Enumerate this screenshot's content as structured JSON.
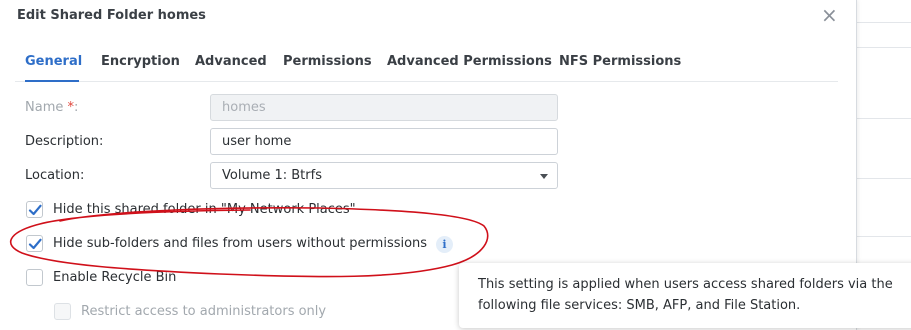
{
  "dialog": {
    "title": "Edit Shared Folder homes",
    "close_symbol": "×"
  },
  "tabs": [
    {
      "label": "General",
      "active": true
    },
    {
      "label": "Encryption",
      "active": false
    },
    {
      "label": "Advanced",
      "active": false
    },
    {
      "label": "Permissions",
      "active": false
    },
    {
      "label": "Advanced Permissions",
      "active": false
    },
    {
      "label": "NFS Permissions",
      "active": false
    }
  ],
  "form": {
    "name_label": "Name",
    "required_mark": "*",
    "name_colon": ":",
    "name_value": "homes",
    "description_label": "Description:",
    "description_value": "user home",
    "location_label": "Location:",
    "location_value": "Volume 1:  Btrfs"
  },
  "options": {
    "hide_folder": {
      "label": "Hide this shared folder in \"My Network Places\"",
      "checked": true
    },
    "hide_subfolders": {
      "label": "Hide sub-folders and files from users without permissions",
      "checked": true
    },
    "recycle_bin": {
      "label": "Enable Recycle Bin",
      "checked": false
    },
    "restrict_admins": {
      "label": "Restrict access to administrators only",
      "checked": false,
      "disabled": true
    }
  },
  "info_icon": "i",
  "tooltip": {
    "line1": "This setting is applied when users access shared folders via the",
    "line2": "following file services: SMB, AFP, and File Station."
  },
  "colors": {
    "accent": "#2e6ec8",
    "required": "#e0453a",
    "annotation": "#d0101a"
  }
}
